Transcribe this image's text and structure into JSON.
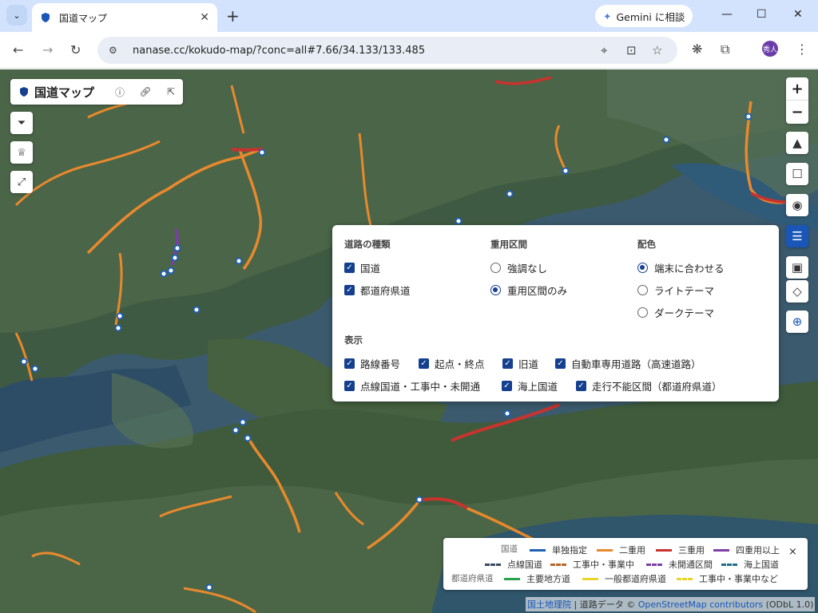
{
  "browser": {
    "tab_title": "国道マップ",
    "gemini_label": "Gemini に相談",
    "url": "nanase.cc/kokudo-map/?conc=all#7.66/34.133/133.485",
    "avatar_text": "秀人",
    "icons": {
      "tab_dropdown": "chevron-down-icon",
      "close_tab": "close-icon",
      "new_tab": "plus-icon",
      "back": "back-arrow-icon",
      "forward": "forward-arrow-icon",
      "reload": "reload-icon",
      "site_settings": "tune-icon",
      "location": "location-pin-icon",
      "install": "install-app-icon",
      "bookmark": "star-icon",
      "openai": "openai-icon",
      "extensions": "puzzle-icon",
      "menu": "kebab-menu-icon"
    }
  },
  "map_title": {
    "name": "国道マップ",
    "icons": [
      "shield-icon",
      "info-icon",
      "link-icon",
      "external-link-icon"
    ]
  },
  "side_buttons": [
    "filter-icon",
    "trophy-icon",
    "route-icon"
  ],
  "right_controls": [
    "zoom-in",
    "zoom-out",
    "compass",
    "square-icon",
    "eye-icon",
    "sliders-icon",
    "image-icon",
    "drop-icon",
    "locate-icon"
  ],
  "zoom": {
    "in": "+",
    "out": "−"
  },
  "settings": {
    "road_type": {
      "heading": "道路の種類",
      "options": [
        {
          "label": "国道",
          "checked": true
        },
        {
          "label": "都道府県道",
          "checked": true
        }
      ]
    },
    "overlap": {
      "heading": "重用区間",
      "options": [
        {
          "label": "強調なし",
          "selected": false
        },
        {
          "label": "重用区間のみ",
          "selected": true
        }
      ]
    },
    "color": {
      "heading": "配色",
      "options": [
        {
          "label": "端末に合わせる",
          "selected": true
        },
        {
          "label": "ライトテーマ",
          "selected": false
        },
        {
          "label": "ダークテーマ",
          "selected": false
        }
      ]
    },
    "display": {
      "heading": "表示",
      "options": [
        {
          "label": "路線番号",
          "checked": true
        },
        {
          "label": "起点・終点",
          "checked": true
        },
        {
          "label": "旧道",
          "checked": true
        },
        {
          "label": "自動車専用道路（高速道路）",
          "checked": true
        },
        {
          "label": "点線国道・工事中・未開通",
          "checked": true
        },
        {
          "label": "海上国道",
          "checked": true
        },
        {
          "label": "走行不能区間（都道府県道）",
          "checked": true
        }
      ]
    }
  },
  "legend": {
    "kokudo_label": "国道",
    "prefectural_label": "都道府県道",
    "close": "×",
    "items": [
      {
        "label": "単独指定",
        "color": "#1e5fb4"
      },
      {
        "label": "二重用",
        "color": "#e8892d"
      },
      {
        "label": "三重用",
        "color": "#c8332e"
      },
      {
        "label": "四重用以上",
        "color": "#7b3fa6"
      },
      {
        "label": "点線国道",
        "color": "#3a4a63"
      },
      {
        "label": "工事中・事業中",
        "color": "#b5652a"
      },
      {
        "label": "未開通区間",
        "color": "#7b3fa6"
      },
      {
        "label": "海上国道",
        "color": "#1f6f8b"
      },
      {
        "label": "主要地方道",
        "color": "#2aa14a"
      },
      {
        "label": "一般都道府県道",
        "color": "#e8d42a"
      },
      {
        "label": "工事中・事業中など",
        "color": "#e8d42a"
      }
    ]
  },
  "attribution": {
    "gsi": "国土地理院",
    "sep": " | 道路データ © ",
    "osm": "OpenStreetMap contributors",
    "license": " (ODbL 1.0)"
  }
}
